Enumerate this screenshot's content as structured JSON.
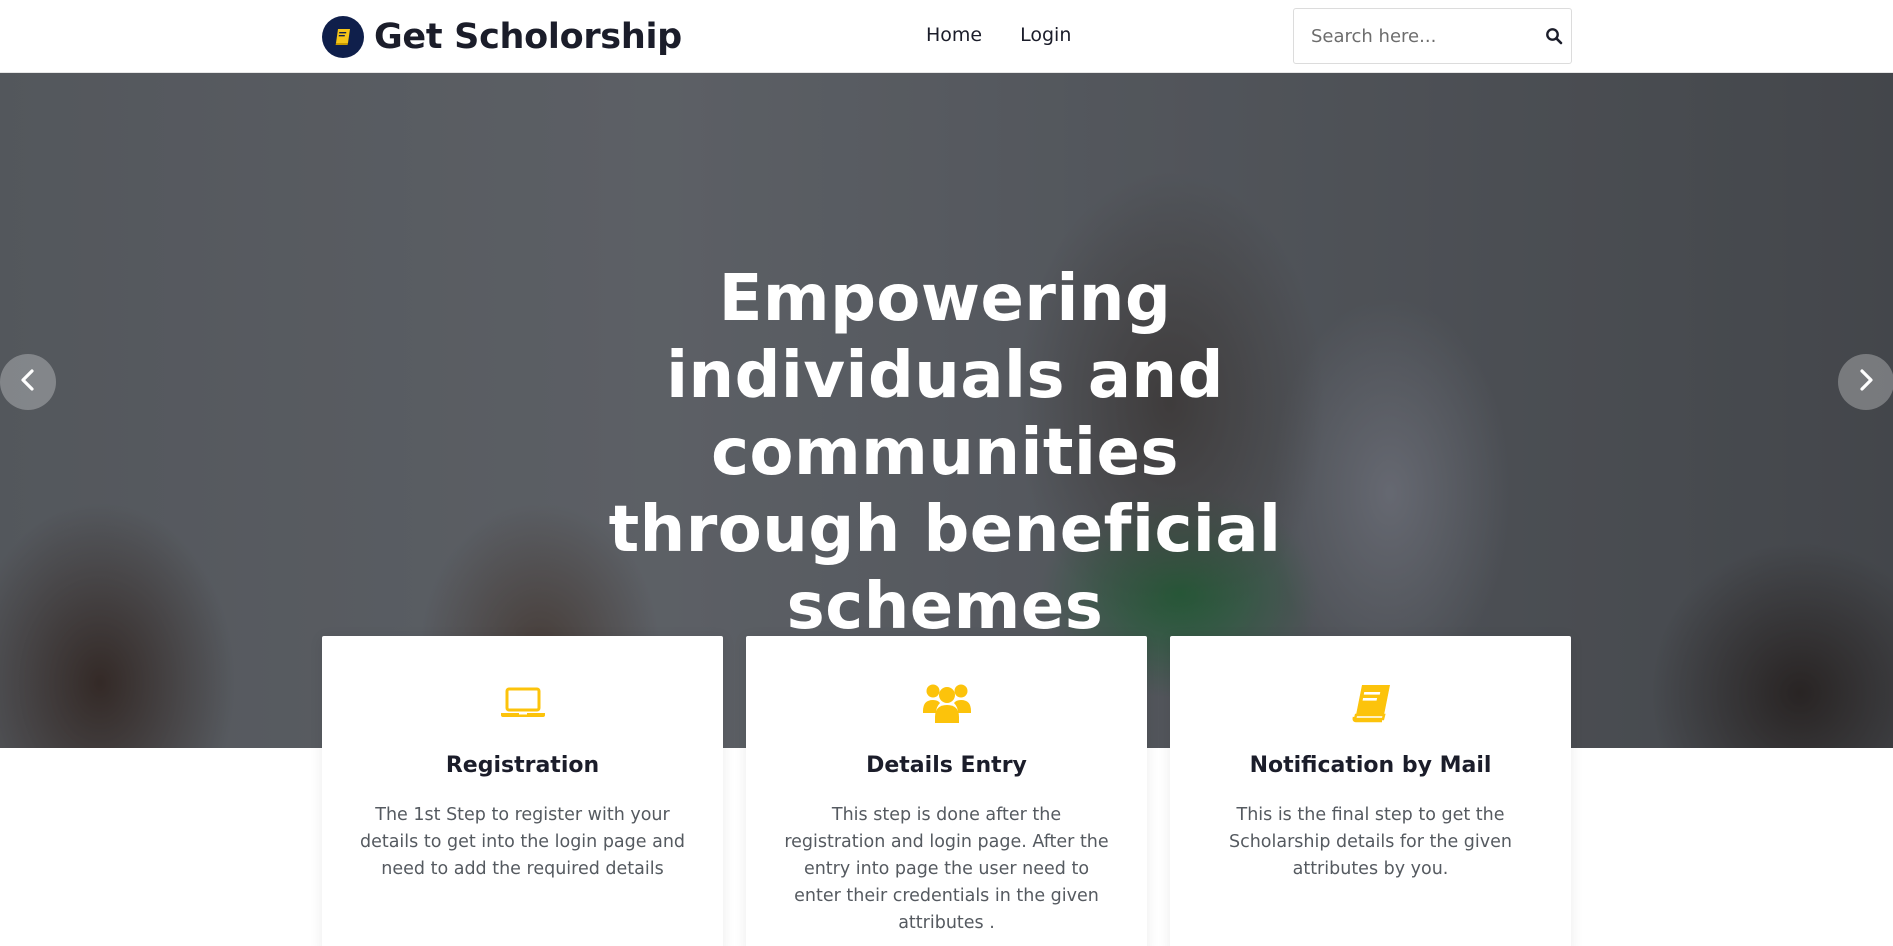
{
  "brand": {
    "name": "Get Scholorship",
    "icon": "book-icon",
    "logo_bg": "#0f1f4b",
    "icon_color": "#f5c518"
  },
  "nav": {
    "items": [
      {
        "label": "Home"
      },
      {
        "label": "Login"
      }
    ]
  },
  "search": {
    "placeholder": "Search here...",
    "value": "",
    "icon": "search-icon"
  },
  "hero": {
    "title": "Empowering individuals and communities through beneficial schemes",
    "prev_icon": "chevron-left-icon",
    "next_icon": "chevron-right-icon"
  },
  "accent_color": "#fcc30b",
  "cards": [
    {
      "icon": "laptop-icon",
      "title": "Registration",
      "text": "The 1st Step to register with your details to get into the login page and need to add the required details"
    },
    {
      "icon": "users-icon",
      "title": "Details Entry",
      "text": "This step is done after the registration and login page. After the entry into page the user need to enter their credentials in the given attributes ."
    },
    {
      "icon": "book-icon",
      "title": "Notification by Mail",
      "text": "This is the final step to get the Scholarship details for the given attributes by you."
    }
  ]
}
